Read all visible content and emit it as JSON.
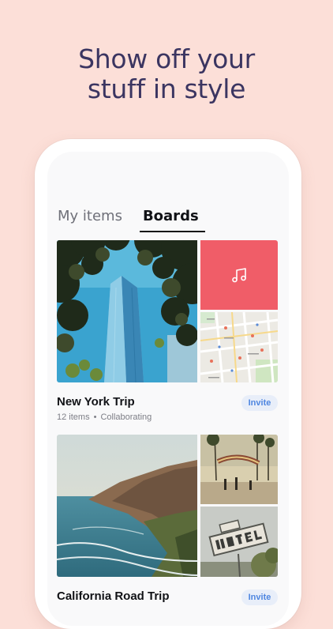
{
  "headline": {
    "line1": "Show off your",
    "line2": "stuff in style"
  },
  "tabs": [
    {
      "label": "My items",
      "active": false
    },
    {
      "label": "Boards",
      "active": true
    }
  ],
  "boards": [
    {
      "title": "New York Trip",
      "item_count": "12 items",
      "separator": "•",
      "status": "Collaborating",
      "invite_label": "Invite",
      "tiles": [
        "skyscraper-photo",
        "music-note-icon",
        "map-thumbnail"
      ]
    },
    {
      "title": "California Road Trip",
      "invite_label": "Invite",
      "tiles": [
        "coastline-photo",
        "boardwalk-photo",
        "motel-sign-photo"
      ]
    }
  ],
  "colors": {
    "background": "#fcdfd8",
    "headline": "#3b3561",
    "music_tile": "#f05d68",
    "invite_text": "#4f86e0",
    "invite_bg": "#e8eef9"
  }
}
